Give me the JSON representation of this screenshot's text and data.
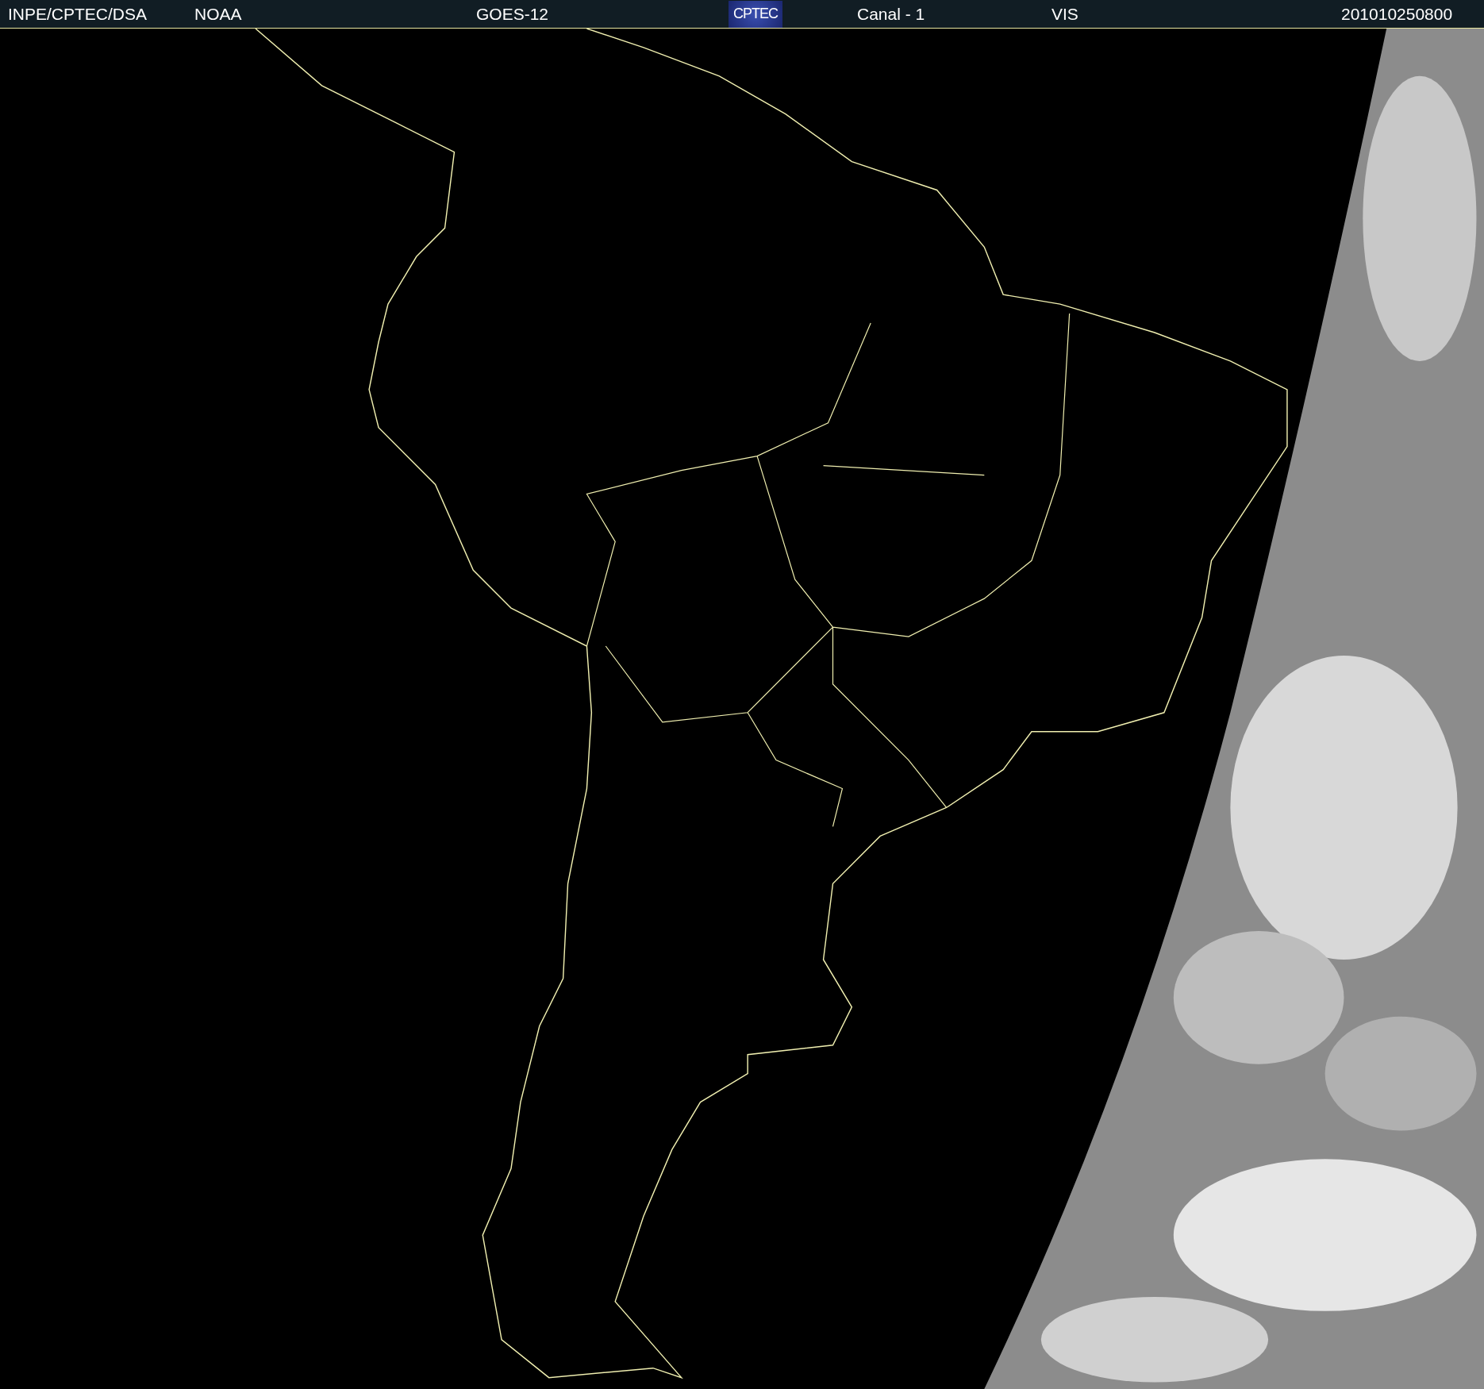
{
  "header": {
    "items": [
      {
        "kind": "text",
        "text": "INPE/CPTEC/DSA"
      },
      {
        "kind": "text",
        "text": "NOAA"
      },
      {
        "kind": "text",
        "text": "GOES-12"
      },
      {
        "kind": "logo",
        "text": "CPTEC"
      },
      {
        "kind": "text",
        "text": "Canal - 1"
      },
      {
        "kind": "text",
        "text": "VIS"
      },
      {
        "kind": "text",
        "text": "201010250800"
      }
    ]
  }
}
